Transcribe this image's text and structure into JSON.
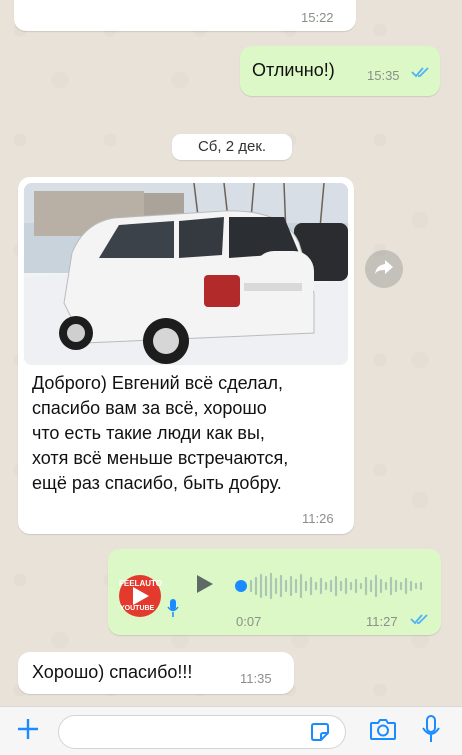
{
  "messages": {
    "top_partial": {
      "time": "15:22"
    },
    "sent_1": {
      "text": "Отлично!)",
      "time": "15:35"
    },
    "date_divider": "Сб, 2 дек.",
    "received_photo": {
      "text_lines": [
        "Доброго) Евгений всё сделал,",
        "спасибо вам за всё, хорошо",
        "что есть такие люди как вы,",
        "хотя всё меньше встречаются,",
        "ещё раз спасибо, быть добру."
      ],
      "time": "11:26"
    },
    "voice": {
      "avatar_top": "FEELAUTO",
      "avatar_bottom": "YOUTUBE",
      "duration": "0:07",
      "time": "11:27"
    },
    "received_2": {
      "text": "Хорошо) спасибо!!!",
      "time": "11:35"
    }
  },
  "icons": {
    "read": "double-check-icon",
    "forward": "forward-arrow-icon",
    "play": "play-icon",
    "mic": "microphone-icon",
    "plus": "plus-icon",
    "sticker": "sticker-icon",
    "camera": "camera-icon"
  },
  "colors": {
    "sent_bubble": "#dcf8c6",
    "received_bubble": "#ffffff",
    "accent": "#1a8cff",
    "read_ticks": "#4fb3f5"
  }
}
